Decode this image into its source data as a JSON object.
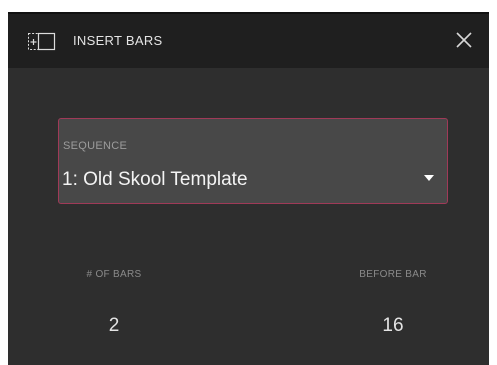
{
  "dialog": {
    "title": "INSERT BARS",
    "title_icon": "insert-bars-icon",
    "close_icon": "close-icon"
  },
  "sequence": {
    "label": "SEQUENCE",
    "value": "1: Old Skool Template",
    "dropdown_icon": "caret-down-icon",
    "border_color": "#a03a58"
  },
  "fields": {
    "num_bars": {
      "label": "# OF BARS",
      "value": "2"
    },
    "before_bar": {
      "label": "BEFORE BAR",
      "value": "16"
    }
  },
  "colors": {
    "background": "#2e2e2e",
    "titlebar": "#1f1f1f",
    "dropdown_bg": "#484848"
  }
}
